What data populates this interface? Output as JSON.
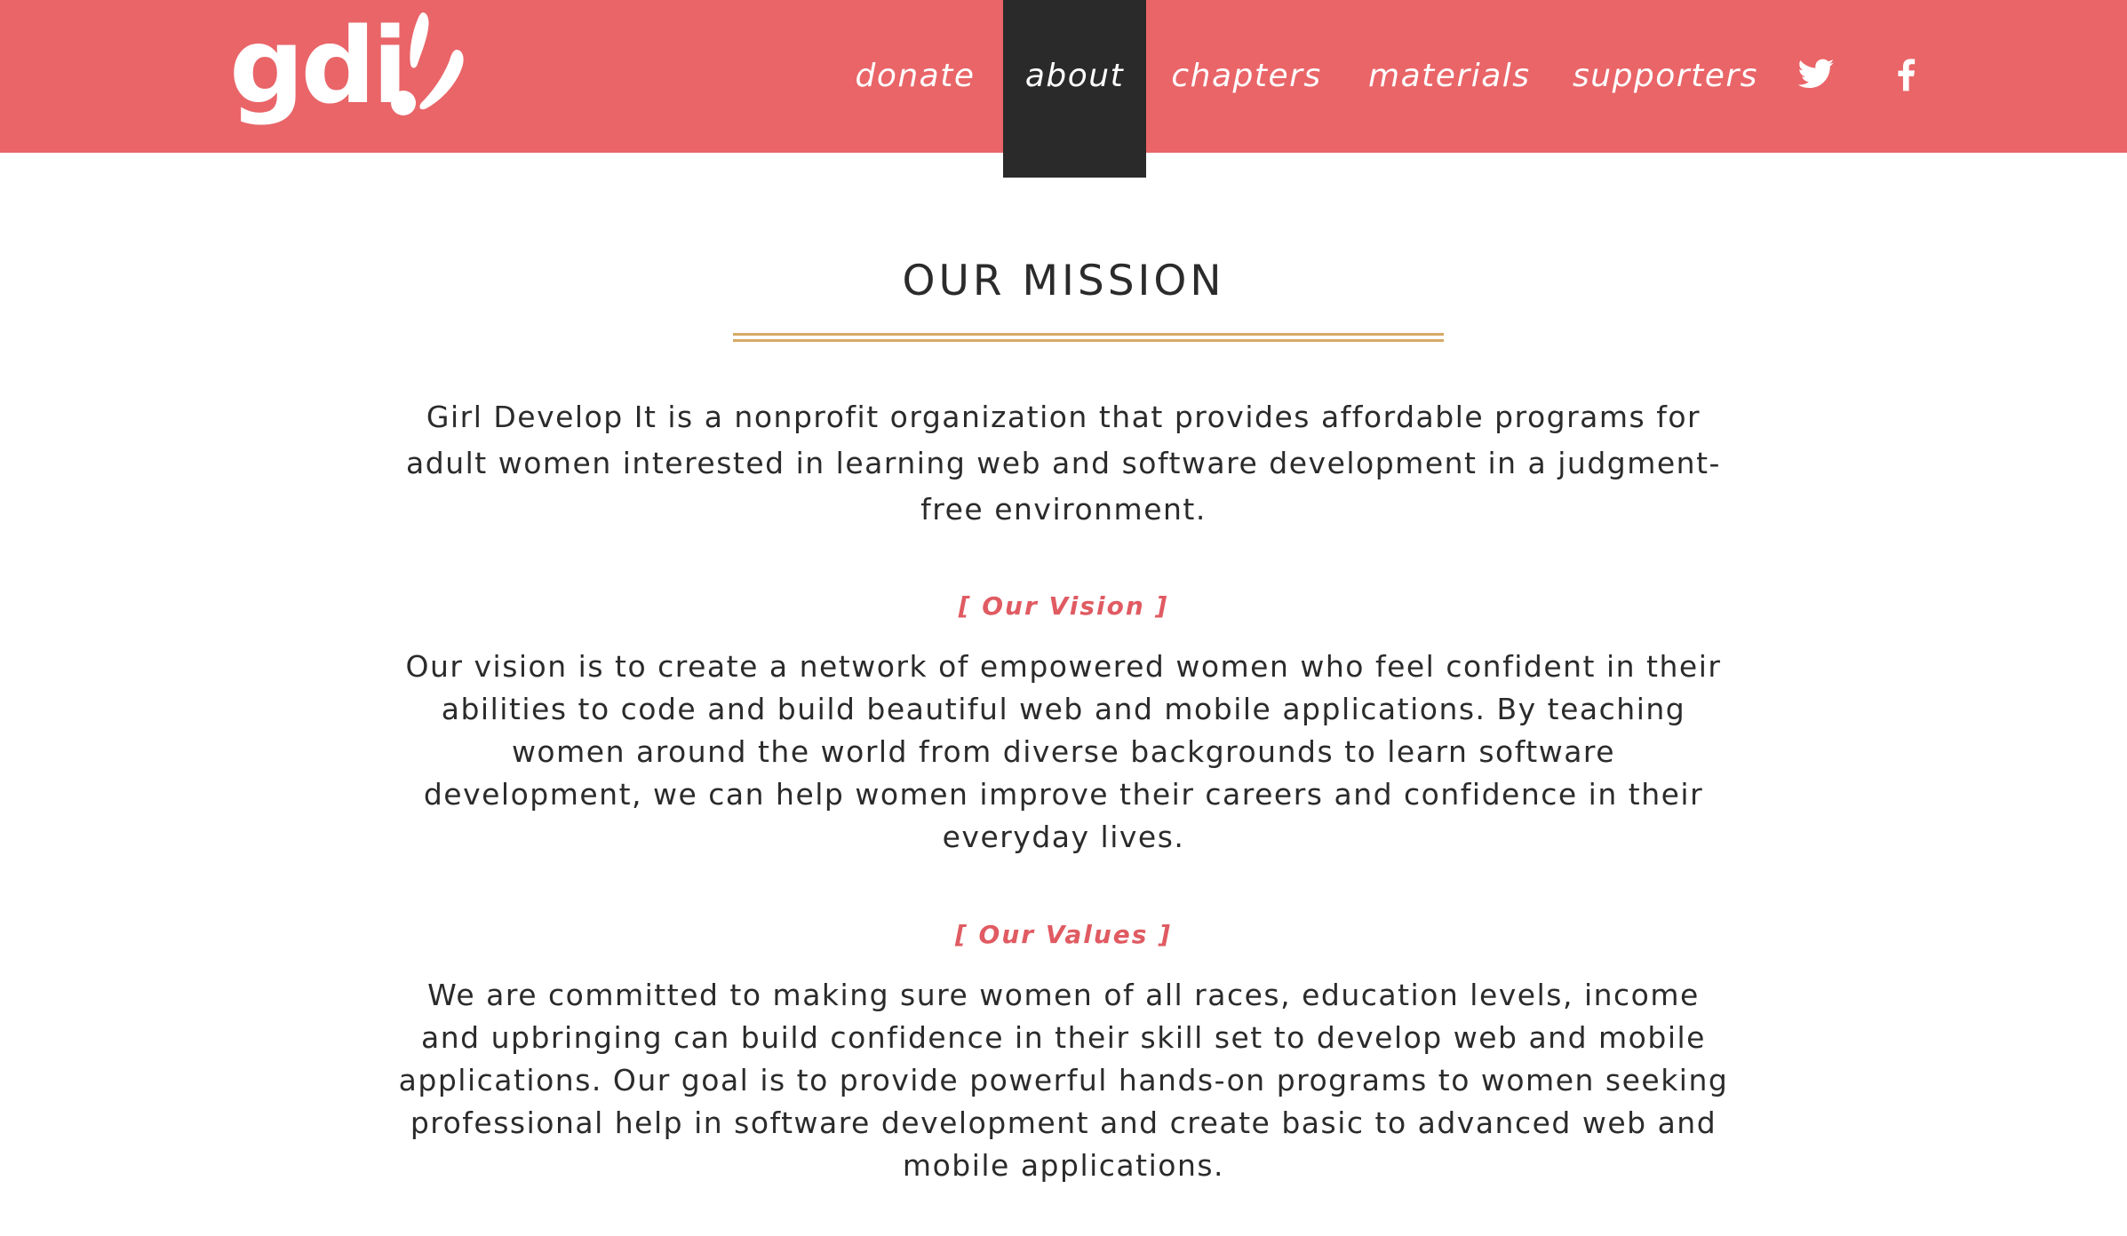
{
  "header": {
    "background_color": "#e96568",
    "logo_text": "gdi",
    "nav": {
      "donate": "donate",
      "about": "about",
      "chapters": "chapters",
      "materials": "materials",
      "supporters": "supporters"
    },
    "active_item": "about",
    "active_color": "#2a2a2a",
    "social_icons": [
      "twitter-icon",
      "facebook-icon"
    ]
  },
  "main": {
    "title": "OUR MISSION",
    "rule_color": "#d6a964",
    "mission_text": "Girl Develop It is a nonprofit organization that provides affordable programs for adult women interested in learning web and software development in a judgment-free environment.",
    "vision_label": "[ Our Vision ]",
    "vision_text": "Our vision is to create a network of empowered women who feel confident in their abilities to code and build beautiful web and mobile applications. By teaching women around the world from diverse backgrounds to learn software development, we can help women improve their careers and confidence in their everyday lives.",
    "values_label": "[ Our Values ]",
    "values_text": "We are committed to making sure women of all races, education levels, income and upbringing can build confidence in their skill set to develop web and mobile applications. Our goal is to provide powerful hands-on programs to women seeking professional help in software development and create basic to advanced web and mobile applications.",
    "label_color": "#e05b62"
  }
}
